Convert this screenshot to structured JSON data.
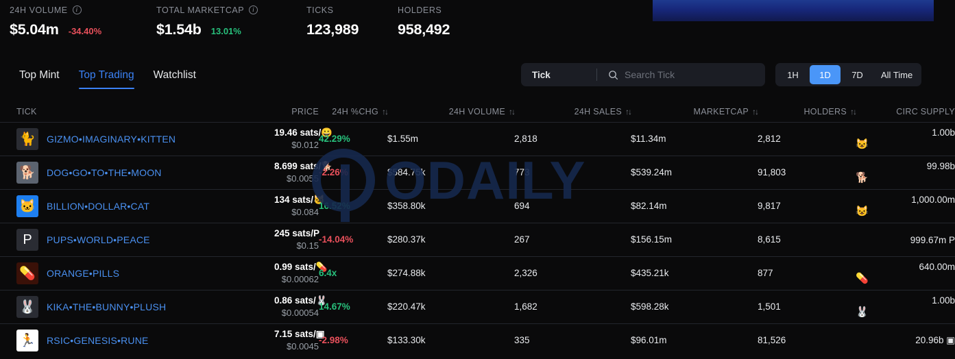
{
  "stats": [
    {
      "label": "24H VOLUME",
      "has_info": true,
      "value": "$5.04m",
      "delta": "-34.40%",
      "delta_dir": "neg"
    },
    {
      "label": "TOTAL MARKETCAP",
      "has_info": true,
      "value": "$1.54b",
      "delta": "13.01%",
      "delta_dir": "pos"
    },
    {
      "label": "TICKS",
      "has_info": false,
      "value": "123,989",
      "delta": "",
      "delta_dir": ""
    },
    {
      "label": "HOLDERS",
      "has_info": false,
      "value": "958,492",
      "delta": "",
      "delta_dir": ""
    }
  ],
  "tabs": [
    {
      "label": "Top Mint",
      "active": false
    },
    {
      "label": "Top Trading",
      "active": true
    },
    {
      "label": "Watchlist",
      "active": false
    }
  ],
  "search": {
    "prefix": "Tick",
    "placeholder": "Search Tick",
    "value": "",
    "icon": "search-icon"
  },
  "ranges": [
    {
      "label": "1H",
      "active": false
    },
    {
      "label": "1D",
      "active": true
    },
    {
      "label": "7D",
      "active": false
    },
    {
      "label": "All Time",
      "active": false
    }
  ],
  "columns": {
    "tick": "TICK",
    "price": "PRICE",
    "chg": "24H %CHG",
    "volume": "24H VOLUME",
    "sales": "24H SALES",
    "marketcap": "MARKETCAP",
    "holders": "HOLDERS",
    "supply": "CIRC SUPPLY",
    "sort_glyph": "↑↓"
  },
  "watermark": {
    "text": "ODAILY"
  },
  "colors": {
    "accent": "#3b82f6",
    "link": "#4a90f0",
    "positive": "#28c07c",
    "negative": "#e8505b",
    "background": "#0a0a0b",
    "panel": "#1b1d24",
    "toggle_active": "#4a96f8"
  },
  "rows": [
    {
      "avatar_emoji": "🐈",
      "avatar_bg": "#2a2c33",
      "name": "GIZMO•IMAGINARY•KITTEN",
      "price_sats": "19.46 sats/😀",
      "price_usd": "$0.012",
      "chg": "42.29%",
      "chg_dir": "pos",
      "volume": "$1.55m",
      "sales": "2,818",
      "marketcap": "$11.34m",
      "holders": "2,812",
      "supply": "1.00b",
      "supply_emoji": "😺"
    },
    {
      "avatar_emoji": "🐕",
      "avatar_bg": "#5c6470",
      "name": "DOG•GO•TO•THE•MOON",
      "price_sats": "8.699 sats/🐕",
      "price_usd": "$0.0055",
      "chg": "-2.26%",
      "chg_dir": "neg",
      "volume": "$584.75k",
      "sales": "773",
      "marketcap": "$539.24m",
      "holders": "91,803",
      "supply": "99.98b",
      "supply_emoji": "🐕"
    },
    {
      "avatar_emoji": "🐱",
      "avatar_bg": "#1e7ff0",
      "name": "BILLION•DOLLAR•CAT",
      "price_sats": "134 sats/🐱",
      "price_usd": "$0.084",
      "chg": "16.52%",
      "chg_dir": "pos",
      "volume": "$358.80k",
      "sales": "694",
      "marketcap": "$82.14m",
      "holders": "9,817",
      "supply": "1,000.00m",
      "supply_emoji": "😺"
    },
    {
      "avatar_emoji": "P",
      "avatar_bg": "#2a2c33",
      "name": "PUPS•WORLD•PEACE",
      "price_sats": "245 sats/P",
      "price_usd": "$0.15",
      "chg": "-14.04%",
      "chg_dir": "neg",
      "volume": "$280.37k",
      "sales": "267",
      "marketcap": "$156.15m",
      "holders": "8,615",
      "supply": "999.67m P",
      "supply_emoji": ""
    },
    {
      "avatar_emoji": "💊",
      "avatar_bg": "#3a1108",
      "name": "ORANGE•PILLS",
      "price_sats": "0.99 sats/💊",
      "price_usd": "$0.00062",
      "chg": "6.4x",
      "chg_dir": "pos",
      "volume": "$274.88k",
      "sales": "2,326",
      "marketcap": "$435.21k",
      "holders": "877",
      "supply": "640.00m",
      "supply_emoji": "💊"
    },
    {
      "avatar_emoji": "🐰",
      "avatar_bg": "#2a2c33",
      "name": "KIKA•THE•BUNNY•PLUSH",
      "price_sats": "0.86 sats/🐰",
      "price_usd": "$0.00054",
      "chg": "14.67%",
      "chg_dir": "pos",
      "volume": "$220.47k",
      "sales": "1,682",
      "marketcap": "$598.28k",
      "holders": "1,501",
      "supply": "1.00b",
      "supply_emoji": "🐰"
    },
    {
      "avatar_emoji": "🏃",
      "avatar_bg": "#ffffff",
      "name": "RSIC•GENESIS•RUNE",
      "price_sats": "7.15 sats/▣",
      "price_usd": "$0.0045",
      "chg": "-2.98%",
      "chg_dir": "neg",
      "volume": "$133.30k",
      "sales": "335",
      "marketcap": "$96.01m",
      "holders": "81,526",
      "supply": "20.96b ▣",
      "supply_emoji": ""
    }
  ]
}
